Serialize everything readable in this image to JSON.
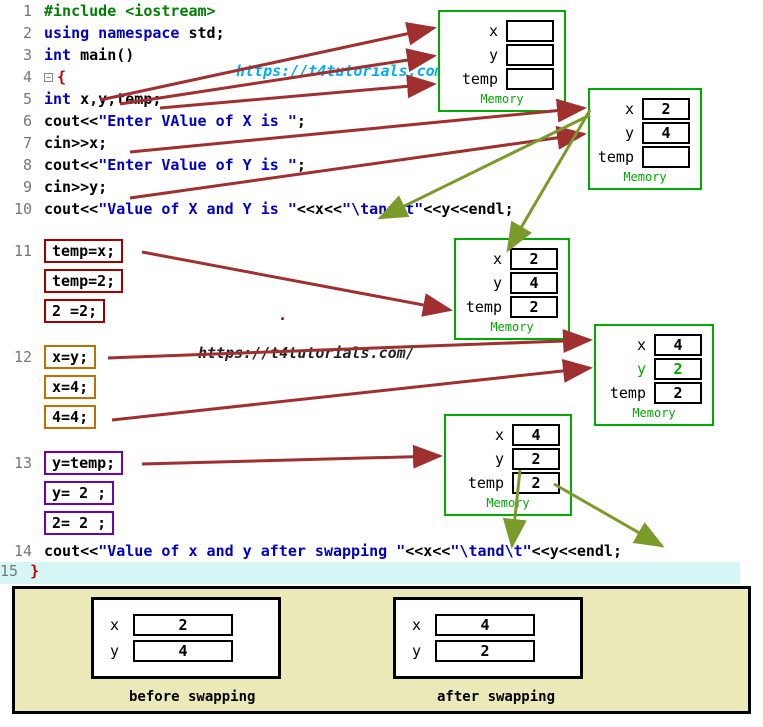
{
  "code": {
    "l1": "#include <iostream>",
    "l2_a": "using namespace ",
    "l2_b": "std",
    "l2_c": ";",
    "l3_a": "int ",
    "l3_b": "main",
    "l3_c": "()",
    "l4": "{",
    "l5_a": "int ",
    "l5_b": "x,y,temp;",
    "l6_a": "cout<<",
    "l6_b": "\"Enter VAlue of X is \"",
    "l6_c": ";",
    "l7": "cin>>x;",
    "l8_a": "cout<<",
    "l8_b": "\"Enter Value of Y is \"",
    "l8_c": ";",
    "l9": "cin>>y;",
    "l10_a": "cout<<",
    "l10_b": "\"Value of X and Y is \"",
    "l10_c": "<<x<<",
    "l10_d": "\"\\tand\\t\"",
    "l10_e": "<<y<<endl;",
    "l11": "temp=x;",
    "l11_e2": "temp=2;",
    "l11_e3": " 2  =2;",
    "l12": "x=y;",
    "l12_e2": "x=4;",
    "l12_e3": "4=4;",
    "l13": "y=temp;",
    "l13_e2": "y= 2  ;",
    "l13_e3": "2= 2  ;",
    "l14_a": "cout<<",
    "l14_b": "\"Value of x and y after swapping \"",
    "l14_c": "<<x<<",
    "l14_d": "\"\\tand\\t\"",
    "l14_e": "<<y<<endl;",
    "l15": "}"
  },
  "url1": "https://t4tutorials.com/",
  "url2": "https://t4tutorials.com/",
  "mem": {
    "a": {
      "x": "",
      "y": "",
      "temp": "",
      "caption": "Memory"
    },
    "b": {
      "x": "2",
      "y": "4",
      "temp": "",
      "caption": "Memory"
    },
    "c": {
      "x": "2",
      "y": "4",
      "temp": "2",
      "caption": "Memory"
    },
    "d": {
      "x": "4",
      "y": "2",
      "temp": "2",
      "caption": "Memory"
    },
    "e": {
      "x": "4",
      "y": "2",
      "temp": "2",
      "caption": "Memory"
    }
  },
  "summary": {
    "before": {
      "x": "2",
      "y": "4",
      "caption": "before swapping"
    },
    "after": {
      "x": "4",
      "y": "2",
      "caption": "after swapping"
    }
  },
  "labels": {
    "x": "x",
    "y": "y",
    "temp": "temp"
  },
  "lineno": {
    "n1": "1",
    "n2": "2",
    "n3": "3",
    "n4": "4",
    "n5": "5",
    "n6": "6",
    "n7": "7",
    "n8": "8",
    "n9": "9",
    "n10": "10",
    "n11": "11",
    "n12": "12",
    "n13": "13",
    "n14": "14",
    "n15": "15"
  }
}
